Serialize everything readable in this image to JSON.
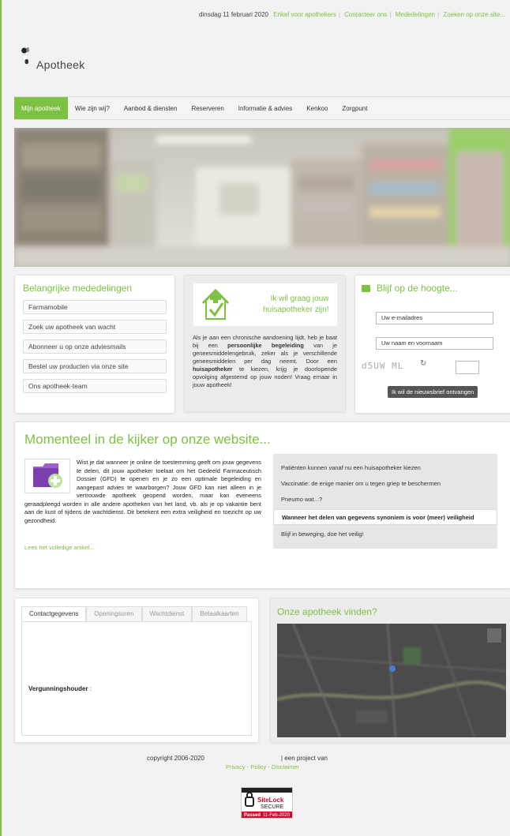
{
  "topbar": {
    "date": "dinsdag 11 februari 2020",
    "links": [
      "Enkel voor apothekers",
      "Contacteer ons",
      "Mededelingen",
      "Zoeken op onze site..."
    ]
  },
  "logo": {
    "brand": "Apotheek"
  },
  "nav": {
    "items": [
      "Mijn apotheek",
      "Wie zijn wij?",
      "Aanbod & diensten",
      "Reserveren",
      "Informatie & advies",
      "Kenkoo",
      "Zorgpunt"
    ]
  },
  "notices": {
    "title": "Belangrijke mededelingen",
    "links": [
      "Farmamobile",
      "Zoek uw apotheek van wacht",
      "Abonneer u op onze adviesmails",
      "Bestel uw producten via onze site",
      "Ons apotheek-team"
    ]
  },
  "promo": {
    "banner_line1": "Ik wil graag jouw",
    "banner_line2": "huisapotheker zijn!",
    "t1": "Als je aan een chronische aandoening lijdt, heb je baat bij een ",
    "b1": "persoonlijke begeleiding",
    "t2": " van je geneesmiddelengebruik, zeker als je verschillende geneesmiddelen per dag neemt. Door een ",
    "b2": "huisapotheker",
    "t3": " te kiezen, krijg je doorlopende opvolging afgestemd op jouw noden! Vraag ernaar in jouw apotheek!"
  },
  "newsletter": {
    "title": "Blijf op de hoogte...",
    "email_value": "Uw e-mailadres",
    "name_value": "Uw naam en voornaam",
    "captcha": "d5UW ML",
    "submit": "Ik wil de nieuwsbrief ontvangen"
  },
  "spotlight": {
    "title": "Momenteel in de kijker op onze website...",
    "article": "Wist je dat wanneer je online de toestemming geeft om jouw gegevens te delen, dit jouw apotheker toelaat om het Gedeeld Farmaceutisch Dossier (GFD) te openen en je zo een optimale begeleiding en aangepast advies te waarborgen? Jouw GFD kan niet alleen in je vertrouwde apotheek geopend worden, maar kan eveneens geraadpleegd worden in alle andere apotheken van het land, vb. als je op vakantie bent aan de kust of tijdens de wachtdienst. Dit betekent een extra veiligheid en toezicht op uw gezondheid.",
    "readmore": "Lees het volledige artikel...",
    "items": [
      "Patiënten kunnen vanaf nu een huisapotheker kiezen",
      "Vaccinatie: de enige manier om u tegen griep te beschermen",
      "Pneumo wat...?",
      "Wanneer het delen van gegevens synoniem is voor (meer) veiligheid",
      "Blijf in beweging, doe het veilig!"
    ],
    "active_index": 3
  },
  "contact": {
    "tabs": [
      "Contactgegevens",
      "Openingsuren",
      "Wachtdienst",
      "Betaalkaarten"
    ],
    "label": "Vergunningshouder",
    "label_suffix": " :"
  },
  "map": {
    "title": "Onze apotheek vinden?"
  },
  "footer": {
    "copyright": "copyright 2006-2020",
    "project": "| een project van",
    "links": "Privacy - Policy - Disclaimer"
  },
  "seal": {
    "name": "SiteLock",
    "secure": "SECURE",
    "passed": "Passed",
    "date": "11-Feb-2020"
  },
  "colors": {
    "accent": "#7cc142",
    "dark": "#555555"
  }
}
